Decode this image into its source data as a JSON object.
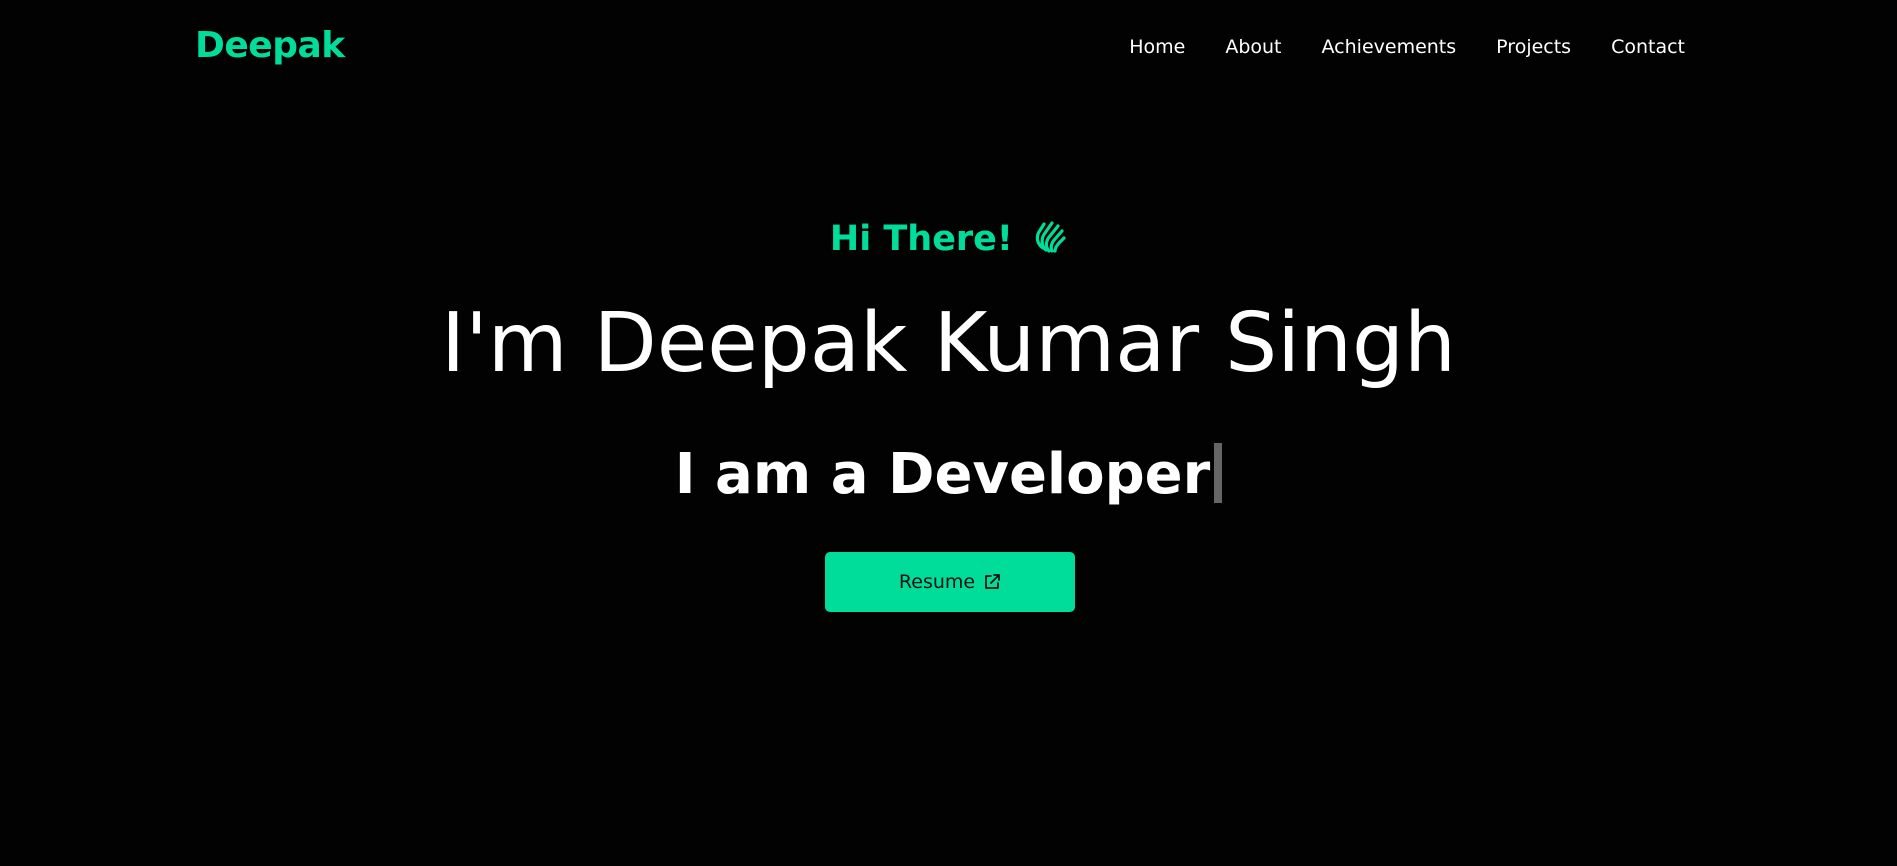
{
  "header": {
    "logo": "Deepak",
    "nav": [
      {
        "label": "Home"
      },
      {
        "label": "About"
      },
      {
        "label": "Achievements"
      },
      {
        "label": "Projects"
      },
      {
        "label": "Contact"
      }
    ]
  },
  "hero": {
    "greeting": "Hi There!",
    "greeting_icon": "waving-hand-icon",
    "name": "I'm Deepak Kumar Singh",
    "role": "I am a Developer",
    "resume_label": "Resume",
    "resume_icon": "external-link-icon"
  },
  "colors": {
    "background": "#020202",
    "accent": "#00dd9a",
    "text": "#ffffff"
  }
}
